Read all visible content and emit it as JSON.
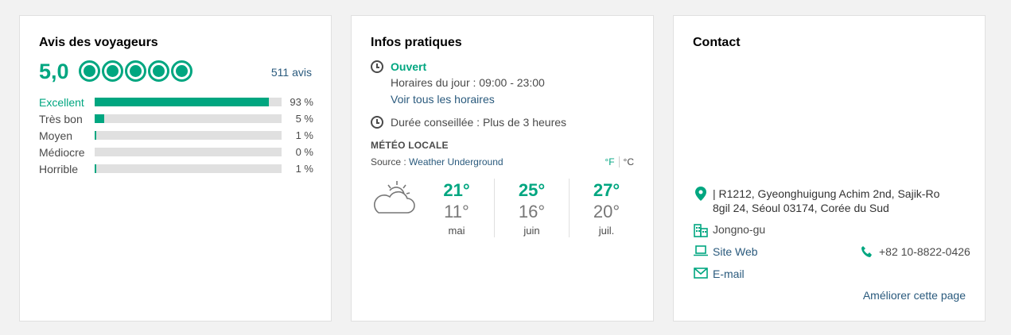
{
  "reviews": {
    "title": "Avis des voyageurs",
    "score": "5,0",
    "bubbles_filled": 5,
    "count_label": "511 avis",
    "rows": [
      {
        "label": "Excellent",
        "pct": "93 %",
        "fraction": 0.93
      },
      {
        "label": "Très bon",
        "pct": "5 %",
        "fraction": 0.05
      },
      {
        "label": "Moyen",
        "pct": "1 %",
        "fraction": 0.01
      },
      {
        "label": "Médiocre",
        "pct": "0 %",
        "fraction": 0.0
      },
      {
        "label": "Horrible",
        "pct": "1 %",
        "fraction": 0.01
      }
    ],
    "accent": "#00a680"
  },
  "infos": {
    "title": "Infos pratiques",
    "status": "Ouvert",
    "hours": "Horaires du jour : 09:00 - 23:00",
    "all_hours_link": "Voir tous les horaires",
    "duration": "Durée conseillée : Plus de 3 heures",
    "meteo_title": "MÉTÉO LOCALE",
    "source_prefix": "Source : ",
    "source_link": "Weather Underground",
    "unit_f": "°F",
    "unit_c": "°C",
    "weather_icon": "partly-cloudy-icon",
    "months": [
      {
        "high": "21°",
        "low": "11°",
        "name": "mai"
      },
      {
        "high": "25°",
        "low": "16°",
        "name": "juin"
      },
      {
        "high": "27°",
        "low": "20°",
        "name": "juil."
      }
    ]
  },
  "contact": {
    "title": "Contact",
    "address": "| R1212, Gyeonghuigung Achim 2nd, Sajik-Ro 8gil 24, Séoul 03174, Corée du Sud",
    "district": "Jongno-gu",
    "website": "Site Web",
    "phone": "+82 10-8822-0426",
    "email": "E-mail",
    "improve": "Améliorer cette page"
  }
}
